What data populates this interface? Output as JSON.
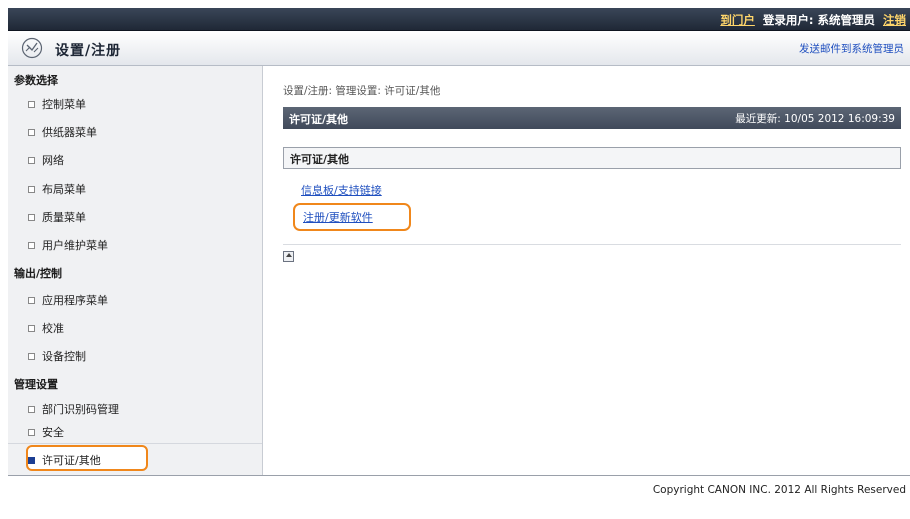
{
  "topbar": {
    "portal": "到门户",
    "login_user": "登录用户: 系统管理员",
    "logout": "注销"
  },
  "header": {
    "title": "设置/注册",
    "mail_admin": "发送邮件到系统管理员"
  },
  "sidebar": {
    "sections": [
      {
        "label": "参数选择",
        "items": [
          "控制菜单",
          "供纸器菜单",
          "网络",
          "布局菜单",
          "质量菜单",
          "用户维护菜单"
        ]
      },
      {
        "label": "输出/控制",
        "items": [
          "应用程序菜单",
          "校准",
          "设备控制"
        ]
      },
      {
        "label": "管理设置",
        "items": [
          "部门识别码管理",
          "安全",
          "许可证/其他"
        ]
      }
    ],
    "selected": "许可证/其他"
  },
  "main": {
    "breadcrumb": "设置/注册: 管理设置: 许可证/其他",
    "title": "许可证/其他",
    "last_updated": "最近更新: 10/05 2012 16:09:39",
    "box_title": "许可证/其他",
    "links": [
      "信息板/支持链接",
      "注册/更新软件"
    ]
  },
  "footer": {
    "copyright": "Copyright CANON INC. 2012 All Rights Reserved"
  },
  "colors": {
    "accent_highlight": "#f0871b",
    "link": "#1f4fbf",
    "topbar": "#2a3445"
  }
}
